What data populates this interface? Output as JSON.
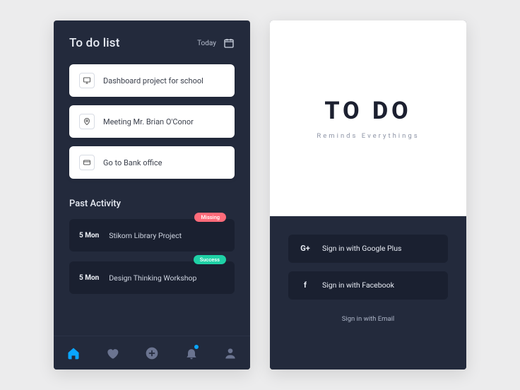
{
  "left": {
    "title": "To do list",
    "today": "Today",
    "tasks": [
      {
        "icon": "monitor",
        "label": "Dashboard project for school"
      },
      {
        "icon": "pin",
        "label": "Meeting Mr. Brian O'Conor"
      },
      {
        "icon": "card",
        "label": "Go to Bank office"
      }
    ],
    "past_title": "Past Activity",
    "past": [
      {
        "date": "5 Mon",
        "title": "Stikom Library Project",
        "badge": "Missing",
        "badge_type": "miss"
      },
      {
        "date": "5 Mon",
        "title": "Design Thinking Workshop",
        "badge": "Success",
        "badge_type": "succ"
      }
    ]
  },
  "right": {
    "brand": "TO DO",
    "tagline": "Reminds Everythings",
    "signin_google": "Sign in with Google Plus",
    "signin_facebook": "Sign in with Facebook",
    "signin_email": "Sign in with Email"
  }
}
